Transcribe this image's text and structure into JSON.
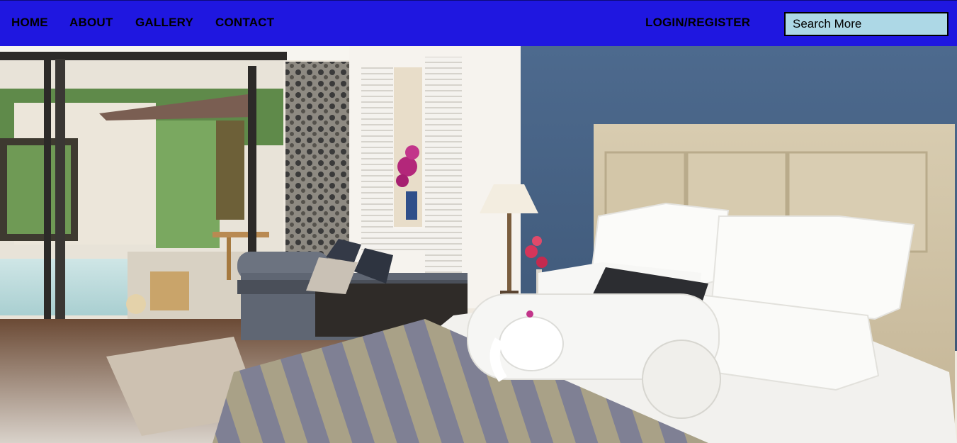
{
  "nav": {
    "home_label": "HOME",
    "about_label": "ABOUT",
    "gallery_label": "GALLERY",
    "contact_label": "CONTACT",
    "login_label": "LOGIN/REGISTER"
  },
  "search": {
    "placeholder": "Search More"
  },
  "colors": {
    "navbar_bg": "#1f17e0",
    "search_bg": "#add8e6",
    "nav_text": "#000000"
  },
  "hero": {
    "subject": "hotel-bedroom-photo"
  }
}
